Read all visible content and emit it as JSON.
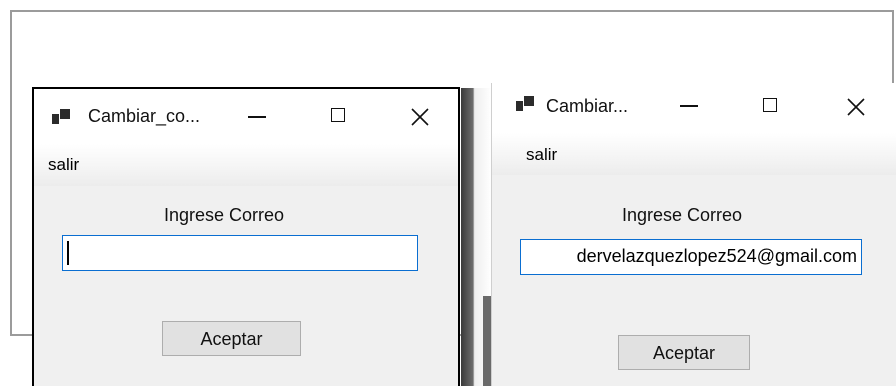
{
  "left_window": {
    "title": "Cambiar_co...",
    "menu": {
      "exit_label": "salir"
    },
    "prompt_label": "Ingrese Correo",
    "email_field": {
      "value": ""
    },
    "accept_label": "Aceptar"
  },
  "right_window": {
    "title": "Cambiar...",
    "menu": {
      "exit_label": "salir"
    },
    "prompt_label": "Ingrese Correo",
    "email_field": {
      "value": "dervelazquezlopez524@gmail.com"
    },
    "accept_label": "Aceptar"
  },
  "icons": {
    "app": "app-window-icon",
    "minimize": "minimize-icon",
    "maximize": "maximize-icon",
    "close": "close-icon"
  },
  "colors": {
    "focus_border": "#0a6ed1",
    "window_bg": "#f0f0f0",
    "button_bg": "#e1e1e1"
  }
}
